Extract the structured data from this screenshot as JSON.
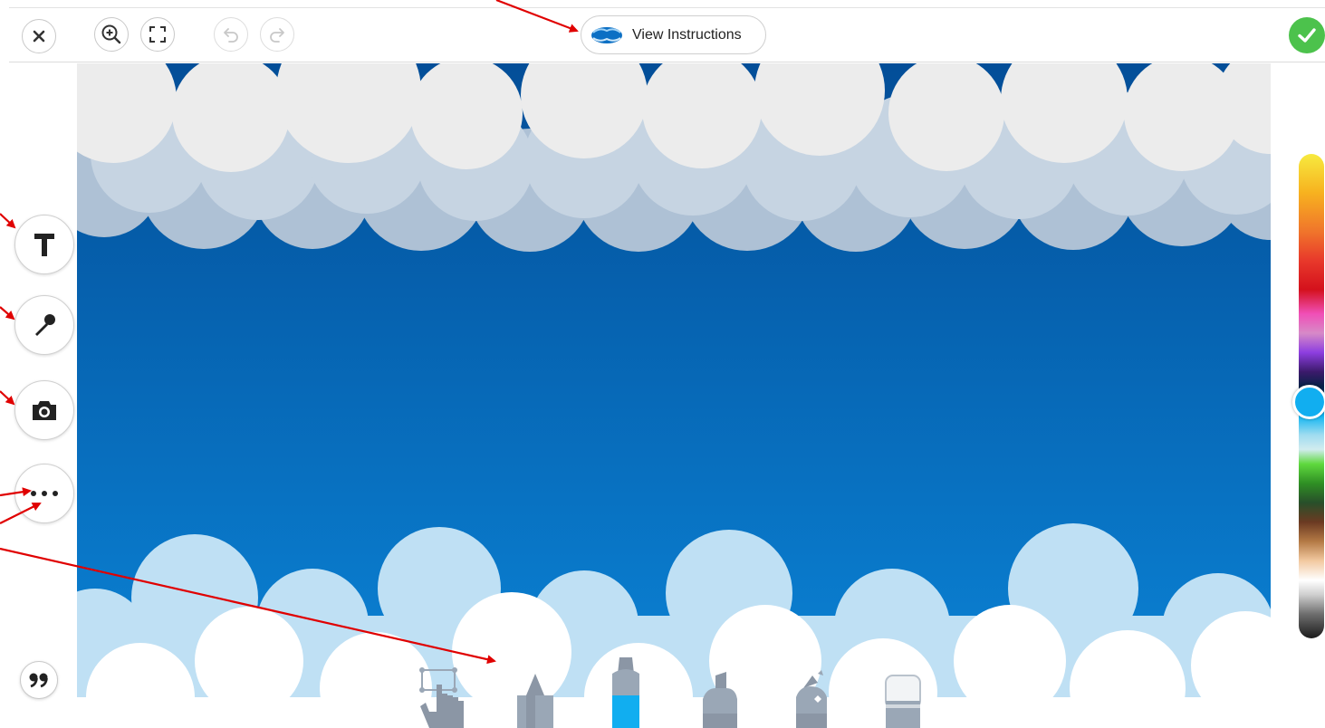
{
  "toolbar": {
    "view_instructions_label": "View Instructions",
    "close_icon": "close-icon",
    "zoom_icon": "zoom-in-icon",
    "fullscreen_icon": "fullscreen-icon",
    "undo_icon": "undo-icon",
    "redo_icon": "redo-icon",
    "done_icon": "check-icon"
  },
  "side_tools": {
    "items": [
      {
        "name": "text-tool",
        "icon": "text-icon"
      },
      {
        "name": "voice-tool",
        "icon": "microphone-icon"
      },
      {
        "name": "camera-tool",
        "icon": "camera-icon"
      },
      {
        "name": "more-tool",
        "icon": "more-icon"
      }
    ],
    "caption_icon": "quote-icon"
  },
  "drawing_tools": {
    "items": [
      {
        "name": "select-tool",
        "icon": "hand-select-icon"
      },
      {
        "name": "pencil-tool",
        "icon": "pencil-icon"
      },
      {
        "name": "marker-tool",
        "icon": "marker-icon",
        "selected": true
      },
      {
        "name": "highlighter-tool",
        "icon": "highlighter-icon"
      },
      {
        "name": "glitter-tool",
        "icon": "glitter-pen-icon"
      },
      {
        "name": "eraser-tool",
        "icon": "eraser-icon"
      }
    ]
  },
  "colors": {
    "selected_color": "#11aef0",
    "sky_top": "#034e98",
    "sky_bottom": "#0b85d8",
    "done_green": "#4cc24c",
    "annotation_arrow": "#e00000"
  },
  "palette": {
    "selected_level": 0.53
  }
}
